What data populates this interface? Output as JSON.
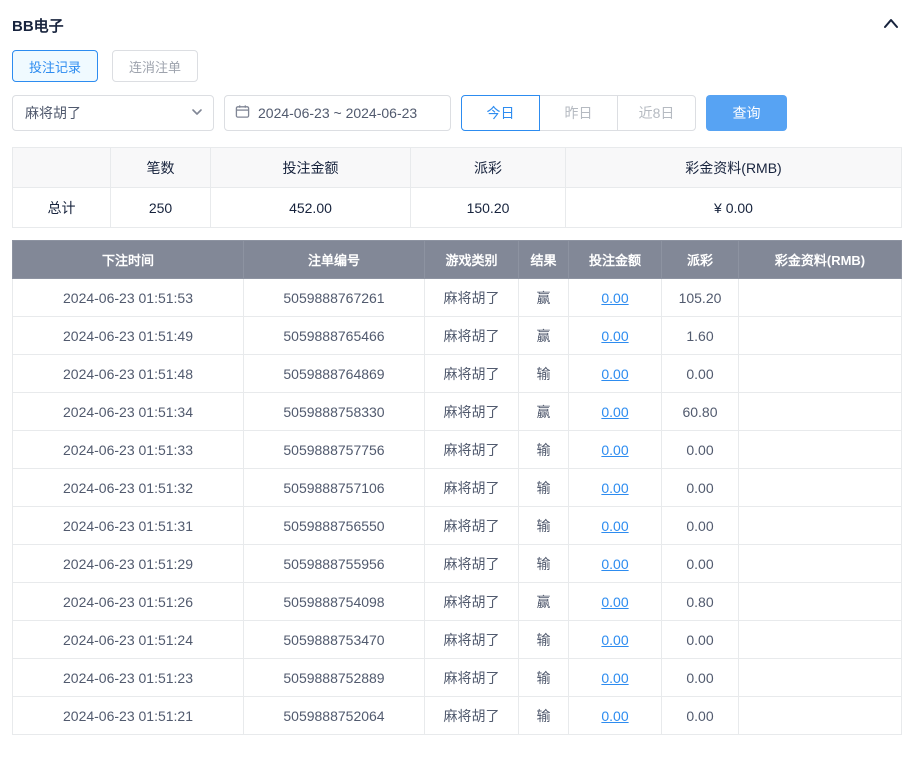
{
  "panel": {
    "title": "BB电子"
  },
  "tabs": {
    "bet_records": "投注记录",
    "cascade_orders": "连消注单"
  },
  "filters": {
    "game_select_value": "麻将胡了",
    "date_range": "2024-06-23 ~ 2024-06-23",
    "quick_today": "今日",
    "quick_yesterday": "昨日",
    "quick_8days": "近8日",
    "search_label": "查询"
  },
  "summary": {
    "headers": [
      "",
      "笔数",
      "投注金额",
      "派彩",
      "彩金资料(RMB)"
    ],
    "total_label": "总计",
    "count": "250",
    "bet_amount": "452.00",
    "payout": "150.20",
    "bonus": "¥ 0.00"
  },
  "table": {
    "headers": [
      "下注时间",
      "注单编号",
      "游戏类别",
      "结果",
      "投注金额",
      "派彩",
      "彩金资料(RMB)"
    ],
    "rows": [
      {
        "time": "2024-06-23 01:51:53",
        "order_id": "5059888767261",
        "game": "麻将胡了",
        "result": "赢",
        "bet": "0.00",
        "payout": "105.20",
        "bonus": ""
      },
      {
        "time": "2024-06-23 01:51:49",
        "order_id": "5059888765466",
        "game": "麻将胡了",
        "result": "赢",
        "bet": "0.00",
        "payout": "1.60",
        "bonus": ""
      },
      {
        "time": "2024-06-23 01:51:48",
        "order_id": "5059888764869",
        "game": "麻将胡了",
        "result": "输",
        "bet": "0.00",
        "payout": "0.00",
        "bonus": ""
      },
      {
        "time": "2024-06-23 01:51:34",
        "order_id": "5059888758330",
        "game": "麻将胡了",
        "result": "赢",
        "bet": "0.00",
        "payout": "60.80",
        "bonus": ""
      },
      {
        "time": "2024-06-23 01:51:33",
        "order_id": "5059888757756",
        "game": "麻将胡了",
        "result": "输",
        "bet": "0.00",
        "payout": "0.00",
        "bonus": ""
      },
      {
        "time": "2024-06-23 01:51:32",
        "order_id": "5059888757106",
        "game": "麻将胡了",
        "result": "输",
        "bet": "0.00",
        "payout": "0.00",
        "bonus": ""
      },
      {
        "time": "2024-06-23 01:51:31",
        "order_id": "5059888756550",
        "game": "麻将胡了",
        "result": "输",
        "bet": "0.00",
        "payout": "0.00",
        "bonus": ""
      },
      {
        "time": "2024-06-23 01:51:29",
        "order_id": "5059888755956",
        "game": "麻将胡了",
        "result": "输",
        "bet": "0.00",
        "payout": "0.00",
        "bonus": ""
      },
      {
        "time": "2024-06-23 01:51:26",
        "order_id": "5059888754098",
        "game": "麻将胡了",
        "result": "赢",
        "bet": "0.00",
        "payout": "0.80",
        "bonus": ""
      },
      {
        "time": "2024-06-23 01:51:24",
        "order_id": "5059888753470",
        "game": "麻将胡了",
        "result": "输",
        "bet": "0.00",
        "payout": "0.00",
        "bonus": ""
      },
      {
        "time": "2024-06-23 01:51:23",
        "order_id": "5059888752889",
        "game": "麻将胡了",
        "result": "输",
        "bet": "0.00",
        "payout": "0.00",
        "bonus": ""
      },
      {
        "time": "2024-06-23 01:51:21",
        "order_id": "5059888752064",
        "game": "麻将胡了",
        "result": "输",
        "bet": "0.00",
        "payout": "0.00",
        "bonus": ""
      }
    ]
  },
  "colors": {
    "accent": "#2d8cf0",
    "search_button": "#57a3f3",
    "table_header_bg": "#828897",
    "border": "#e8eaec"
  }
}
